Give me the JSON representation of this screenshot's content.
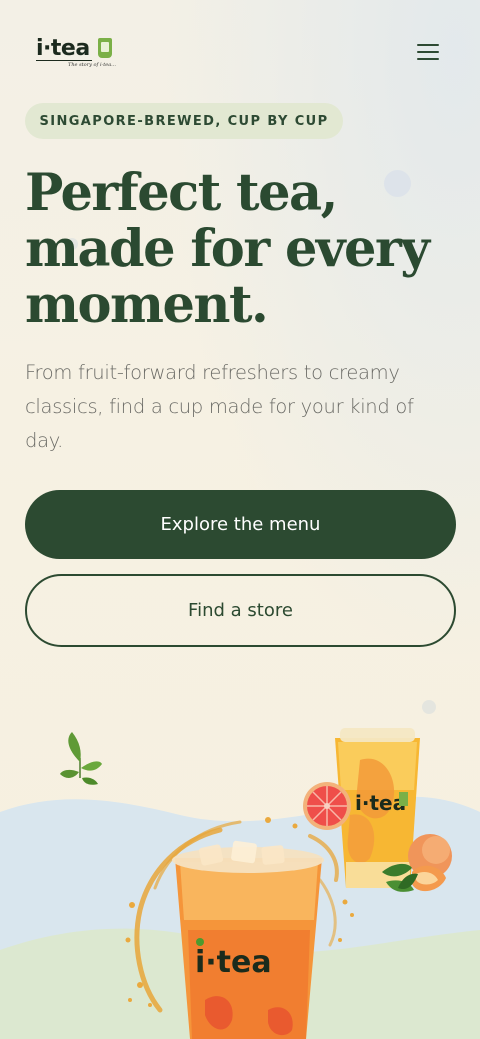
{
  "header": {
    "logo_text": "i·tea",
    "logo_tagline": "The story of i-tea..."
  },
  "hero": {
    "tag": "SINGAPORE-BREWED, CUP BY CUP",
    "headline_lines": [
      "Perfect tea,",
      "made for every",
      "moment."
    ],
    "subtext": "From fruit-forward refreshers to creamy classics, find a cup made for your kind of day.",
    "primary_cta": "Explore the menu",
    "secondary_cta": "Find a store"
  },
  "illustration": {
    "cup_logo": "i·tea",
    "small_cup_logo": "i·tea"
  },
  "colors": {
    "brand_green": "#2c4a31",
    "pill_bg": "#e2e8d2",
    "background": "#f6f1e3"
  },
  "icons": {
    "menu": "hamburger-menu-icon",
    "leaf": "tea-leaf-icon"
  }
}
